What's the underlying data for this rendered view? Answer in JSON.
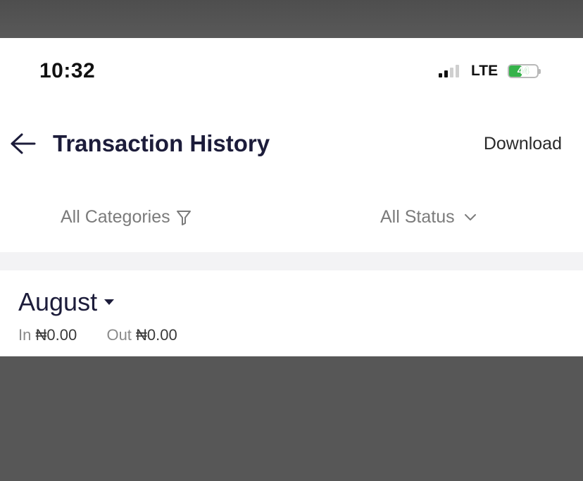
{
  "status_bar": {
    "time": "10:32",
    "network": "LTE",
    "battery_level": "44",
    "signal_bars_active": 2,
    "signal_bars_total": 4,
    "battery_color": "#35b34a"
  },
  "header": {
    "title": "Transaction History",
    "download_label": "Download",
    "back_icon": "arrow-left-icon"
  },
  "filters": {
    "categories_label": "All Categories",
    "categories_icon": "filter-icon",
    "status_label": "All Status",
    "status_icon": "chevron-down-icon"
  },
  "summary": {
    "month": "August",
    "in_label": "In",
    "in_amount": "₦0.00",
    "out_label": "Out",
    "out_amount": "₦0.00"
  },
  "colors": {
    "title": "#1c1c3a",
    "muted": "#7b7b7b",
    "backdrop": "#575757"
  }
}
